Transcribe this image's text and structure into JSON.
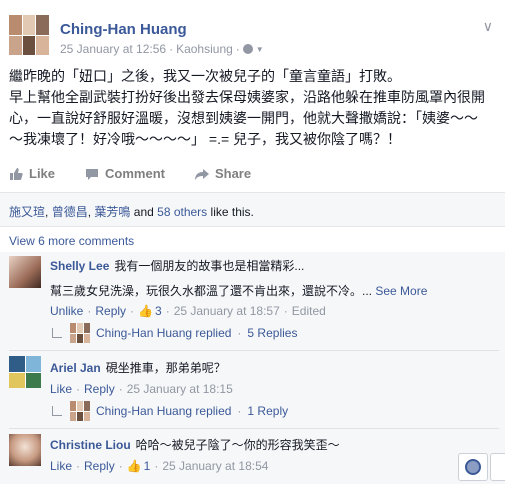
{
  "post": {
    "author": "Ching-Han Huang",
    "date": "25 January at 12:56",
    "dot": "·",
    "location": "Kaohsiung",
    "dot2": "·",
    "body_lines": [
      "繼昨晚的「妞口」之後，我又一次被兒子的「童言童語」打敗。",
      "早上幫他全副武裝打扮好後出發去保母姨婆家，沿路他躲在推車防風罩內很開",
      "心，一直說好舒服好溫暖，沒想到姨婆一開門，他就大聲撒嬌說：「姨婆～～",
      "～我凍壞了！好冷哦～～～～」 =.= 兒子，我又被你陰了嗎？！"
    ]
  },
  "actions": {
    "like": "Like",
    "comment": "Comment",
    "share": "Share"
  },
  "likes": {
    "names": [
      "施又瑄",
      "曾德昌",
      "葉芳鳴"
    ],
    "sep1": ",",
    "sep2": ",",
    "and": "and",
    "others": "58 others",
    "suffix": "like this."
  },
  "view_more": "View 6 more comments",
  "comments": [
    {
      "name": "Shelly Lee",
      "text": "我有一個朋友的故事也是相當精彩...",
      "text2": "幫三歲女兒洗澡，玩很久水都溫了還不肯出來，還說不冷。...",
      "see_more": "See More",
      "unlike": "Unlike",
      "reply": "Reply",
      "likes": "3",
      "time": "25 January at 18:57",
      "edited": "Edited",
      "reply_author": "Ching-Han Huang replied",
      "reply_count": "5 Replies",
      "dot": "·"
    },
    {
      "name": "Ariel Jan",
      "text": "硯坐推車，那弟弟呢？",
      "like": "Like",
      "reply": "Reply",
      "time": "25 January at 18:15",
      "reply_author": "Ching-Han Huang replied",
      "reply_count": "1 Reply",
      "dot": "·"
    },
    {
      "name": "Christine Liou",
      "text": "哈哈～被兒子陰了～你的形容我笑歪～",
      "like": "Like",
      "reply": "Reply",
      "likes": "1",
      "time": "25 January at 18:54",
      "dot": "·"
    }
  ],
  "icons": {
    "chevron": "chevron-down-icon",
    "globe": "globe-icon",
    "like": "thumbs-up-icon",
    "comment": "speech-bubble-icon",
    "share": "share-arrow-icon",
    "chat": "chat-globe-icon"
  },
  "colors": {
    "link": "#3b5998",
    "meta": "#9197a3",
    "text": "#141823",
    "panel": "#f6f7f8"
  }
}
